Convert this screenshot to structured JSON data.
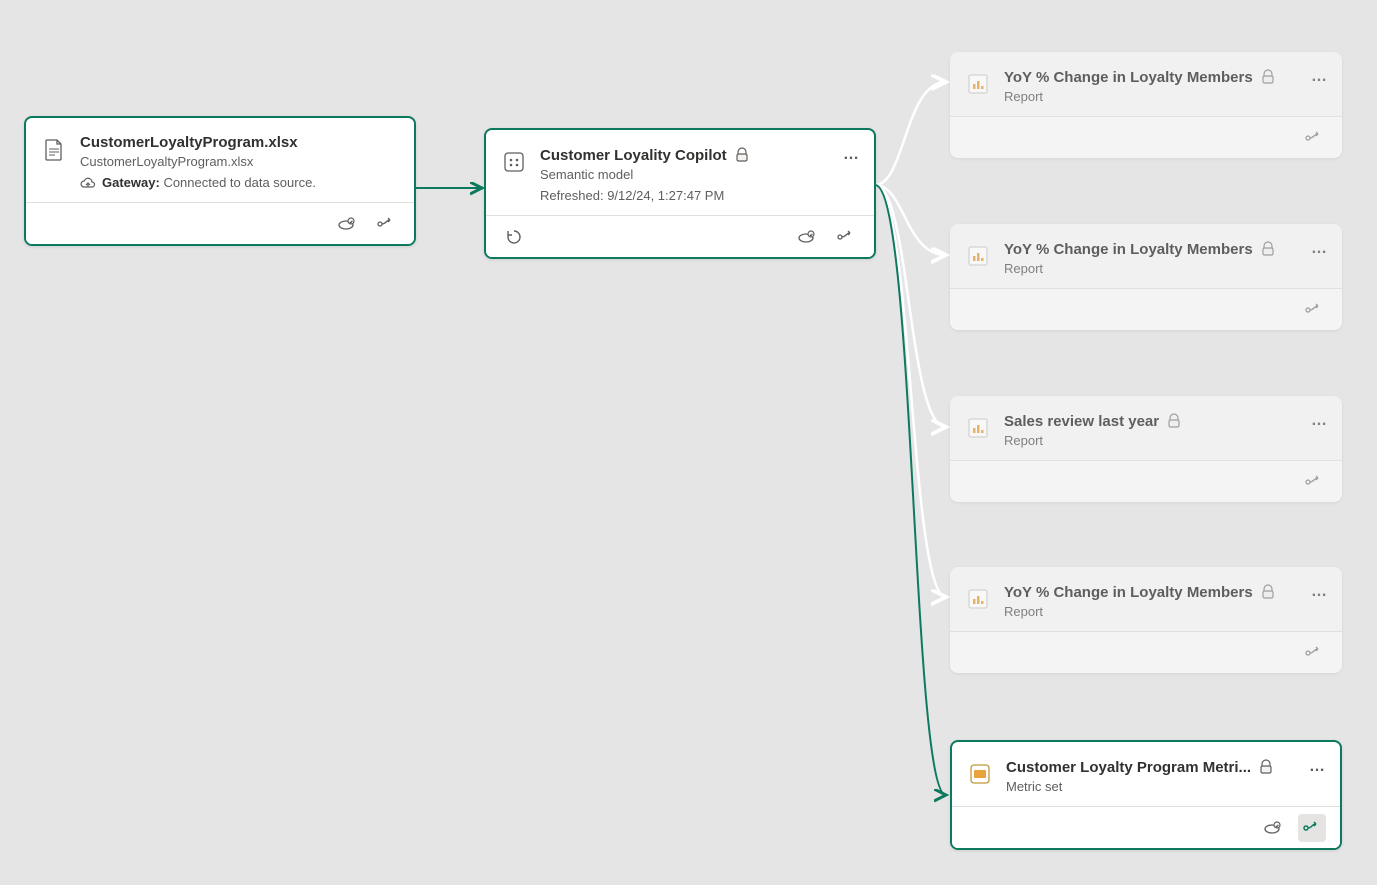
{
  "nodes": {
    "source": {
      "title": "CustomerLoyaltyProgram.xlsx",
      "subtitle": "CustomerLoyaltyProgram.xlsx",
      "gateway_label": "Gateway:",
      "gateway_status": "Connected to data source."
    },
    "model": {
      "title": "Customer Loyality Copilot",
      "subtitle": "Semantic model",
      "refreshed": "Refreshed: 9/12/24, 1:27:47 PM"
    },
    "reports": [
      {
        "title": "YoY % Change in Loyalty Members",
        "subtitle": "Report"
      },
      {
        "title": "YoY % Change in Loyalty Members",
        "subtitle": "Report"
      },
      {
        "title": "Sales review last year",
        "subtitle": "Report"
      },
      {
        "title": "YoY % Change in Loyalty Members",
        "subtitle": "Report"
      }
    ],
    "metric": {
      "title": "Customer Loyalty Program Metri...",
      "subtitle": "Metric set"
    }
  },
  "colors": {
    "accent": "#0d7a5f",
    "mutedConnector": "#ffffff",
    "text": "#323130",
    "subtext": "#605e5c"
  }
}
